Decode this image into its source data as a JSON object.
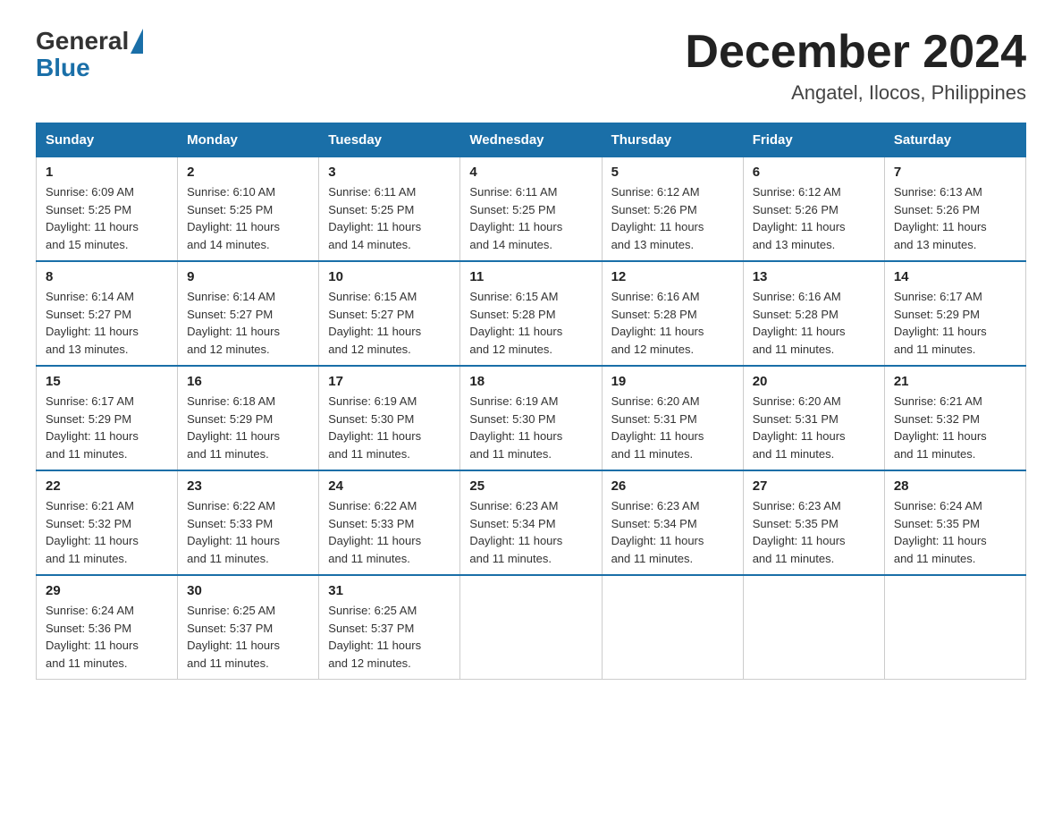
{
  "logo": {
    "text_general": "General",
    "text_blue": "Blue"
  },
  "title": "December 2024",
  "subtitle": "Angatel, Ilocos, Philippines",
  "days_of_week": [
    "Sunday",
    "Monday",
    "Tuesday",
    "Wednesday",
    "Thursday",
    "Friday",
    "Saturday"
  ],
  "weeks": [
    [
      {
        "day": "1",
        "sunrise": "6:09 AM",
        "sunset": "5:25 PM",
        "daylight": "11 hours and 15 minutes."
      },
      {
        "day": "2",
        "sunrise": "6:10 AM",
        "sunset": "5:25 PM",
        "daylight": "11 hours and 14 minutes."
      },
      {
        "day": "3",
        "sunrise": "6:11 AM",
        "sunset": "5:25 PM",
        "daylight": "11 hours and 14 minutes."
      },
      {
        "day": "4",
        "sunrise": "6:11 AM",
        "sunset": "5:25 PM",
        "daylight": "11 hours and 14 minutes."
      },
      {
        "day": "5",
        "sunrise": "6:12 AM",
        "sunset": "5:26 PM",
        "daylight": "11 hours and 13 minutes."
      },
      {
        "day": "6",
        "sunrise": "6:12 AM",
        "sunset": "5:26 PM",
        "daylight": "11 hours and 13 minutes."
      },
      {
        "day": "7",
        "sunrise": "6:13 AM",
        "sunset": "5:26 PM",
        "daylight": "11 hours and 13 minutes."
      }
    ],
    [
      {
        "day": "8",
        "sunrise": "6:14 AM",
        "sunset": "5:27 PM",
        "daylight": "11 hours and 13 minutes."
      },
      {
        "day": "9",
        "sunrise": "6:14 AM",
        "sunset": "5:27 PM",
        "daylight": "11 hours and 12 minutes."
      },
      {
        "day": "10",
        "sunrise": "6:15 AM",
        "sunset": "5:27 PM",
        "daylight": "11 hours and 12 minutes."
      },
      {
        "day": "11",
        "sunrise": "6:15 AM",
        "sunset": "5:28 PM",
        "daylight": "11 hours and 12 minutes."
      },
      {
        "day": "12",
        "sunrise": "6:16 AM",
        "sunset": "5:28 PM",
        "daylight": "11 hours and 12 minutes."
      },
      {
        "day": "13",
        "sunrise": "6:16 AM",
        "sunset": "5:28 PM",
        "daylight": "11 hours and 11 minutes."
      },
      {
        "day": "14",
        "sunrise": "6:17 AM",
        "sunset": "5:29 PM",
        "daylight": "11 hours and 11 minutes."
      }
    ],
    [
      {
        "day": "15",
        "sunrise": "6:17 AM",
        "sunset": "5:29 PM",
        "daylight": "11 hours and 11 minutes."
      },
      {
        "day": "16",
        "sunrise": "6:18 AM",
        "sunset": "5:29 PM",
        "daylight": "11 hours and 11 minutes."
      },
      {
        "day": "17",
        "sunrise": "6:19 AM",
        "sunset": "5:30 PM",
        "daylight": "11 hours and 11 minutes."
      },
      {
        "day": "18",
        "sunrise": "6:19 AM",
        "sunset": "5:30 PM",
        "daylight": "11 hours and 11 minutes."
      },
      {
        "day": "19",
        "sunrise": "6:20 AM",
        "sunset": "5:31 PM",
        "daylight": "11 hours and 11 minutes."
      },
      {
        "day": "20",
        "sunrise": "6:20 AM",
        "sunset": "5:31 PM",
        "daylight": "11 hours and 11 minutes."
      },
      {
        "day": "21",
        "sunrise": "6:21 AM",
        "sunset": "5:32 PM",
        "daylight": "11 hours and 11 minutes."
      }
    ],
    [
      {
        "day": "22",
        "sunrise": "6:21 AM",
        "sunset": "5:32 PM",
        "daylight": "11 hours and 11 minutes."
      },
      {
        "day": "23",
        "sunrise": "6:22 AM",
        "sunset": "5:33 PM",
        "daylight": "11 hours and 11 minutes."
      },
      {
        "day": "24",
        "sunrise": "6:22 AM",
        "sunset": "5:33 PM",
        "daylight": "11 hours and 11 minutes."
      },
      {
        "day": "25",
        "sunrise": "6:23 AM",
        "sunset": "5:34 PM",
        "daylight": "11 hours and 11 minutes."
      },
      {
        "day": "26",
        "sunrise": "6:23 AM",
        "sunset": "5:34 PM",
        "daylight": "11 hours and 11 minutes."
      },
      {
        "day": "27",
        "sunrise": "6:23 AM",
        "sunset": "5:35 PM",
        "daylight": "11 hours and 11 minutes."
      },
      {
        "day": "28",
        "sunrise": "6:24 AM",
        "sunset": "5:35 PM",
        "daylight": "11 hours and 11 minutes."
      }
    ],
    [
      {
        "day": "29",
        "sunrise": "6:24 AM",
        "sunset": "5:36 PM",
        "daylight": "11 hours and 11 minutes."
      },
      {
        "day": "30",
        "sunrise": "6:25 AM",
        "sunset": "5:37 PM",
        "daylight": "11 hours and 11 minutes."
      },
      {
        "day": "31",
        "sunrise": "6:25 AM",
        "sunset": "5:37 PM",
        "daylight": "11 hours and 12 minutes."
      },
      {
        "day": "",
        "sunrise": "",
        "sunset": "",
        "daylight": ""
      },
      {
        "day": "",
        "sunrise": "",
        "sunset": "",
        "daylight": ""
      },
      {
        "day": "",
        "sunrise": "",
        "sunset": "",
        "daylight": ""
      },
      {
        "day": "",
        "sunrise": "",
        "sunset": "",
        "daylight": ""
      }
    ]
  ],
  "labels": {
    "sunrise": "Sunrise:",
    "sunset": "Sunset:",
    "daylight": "Daylight:"
  }
}
